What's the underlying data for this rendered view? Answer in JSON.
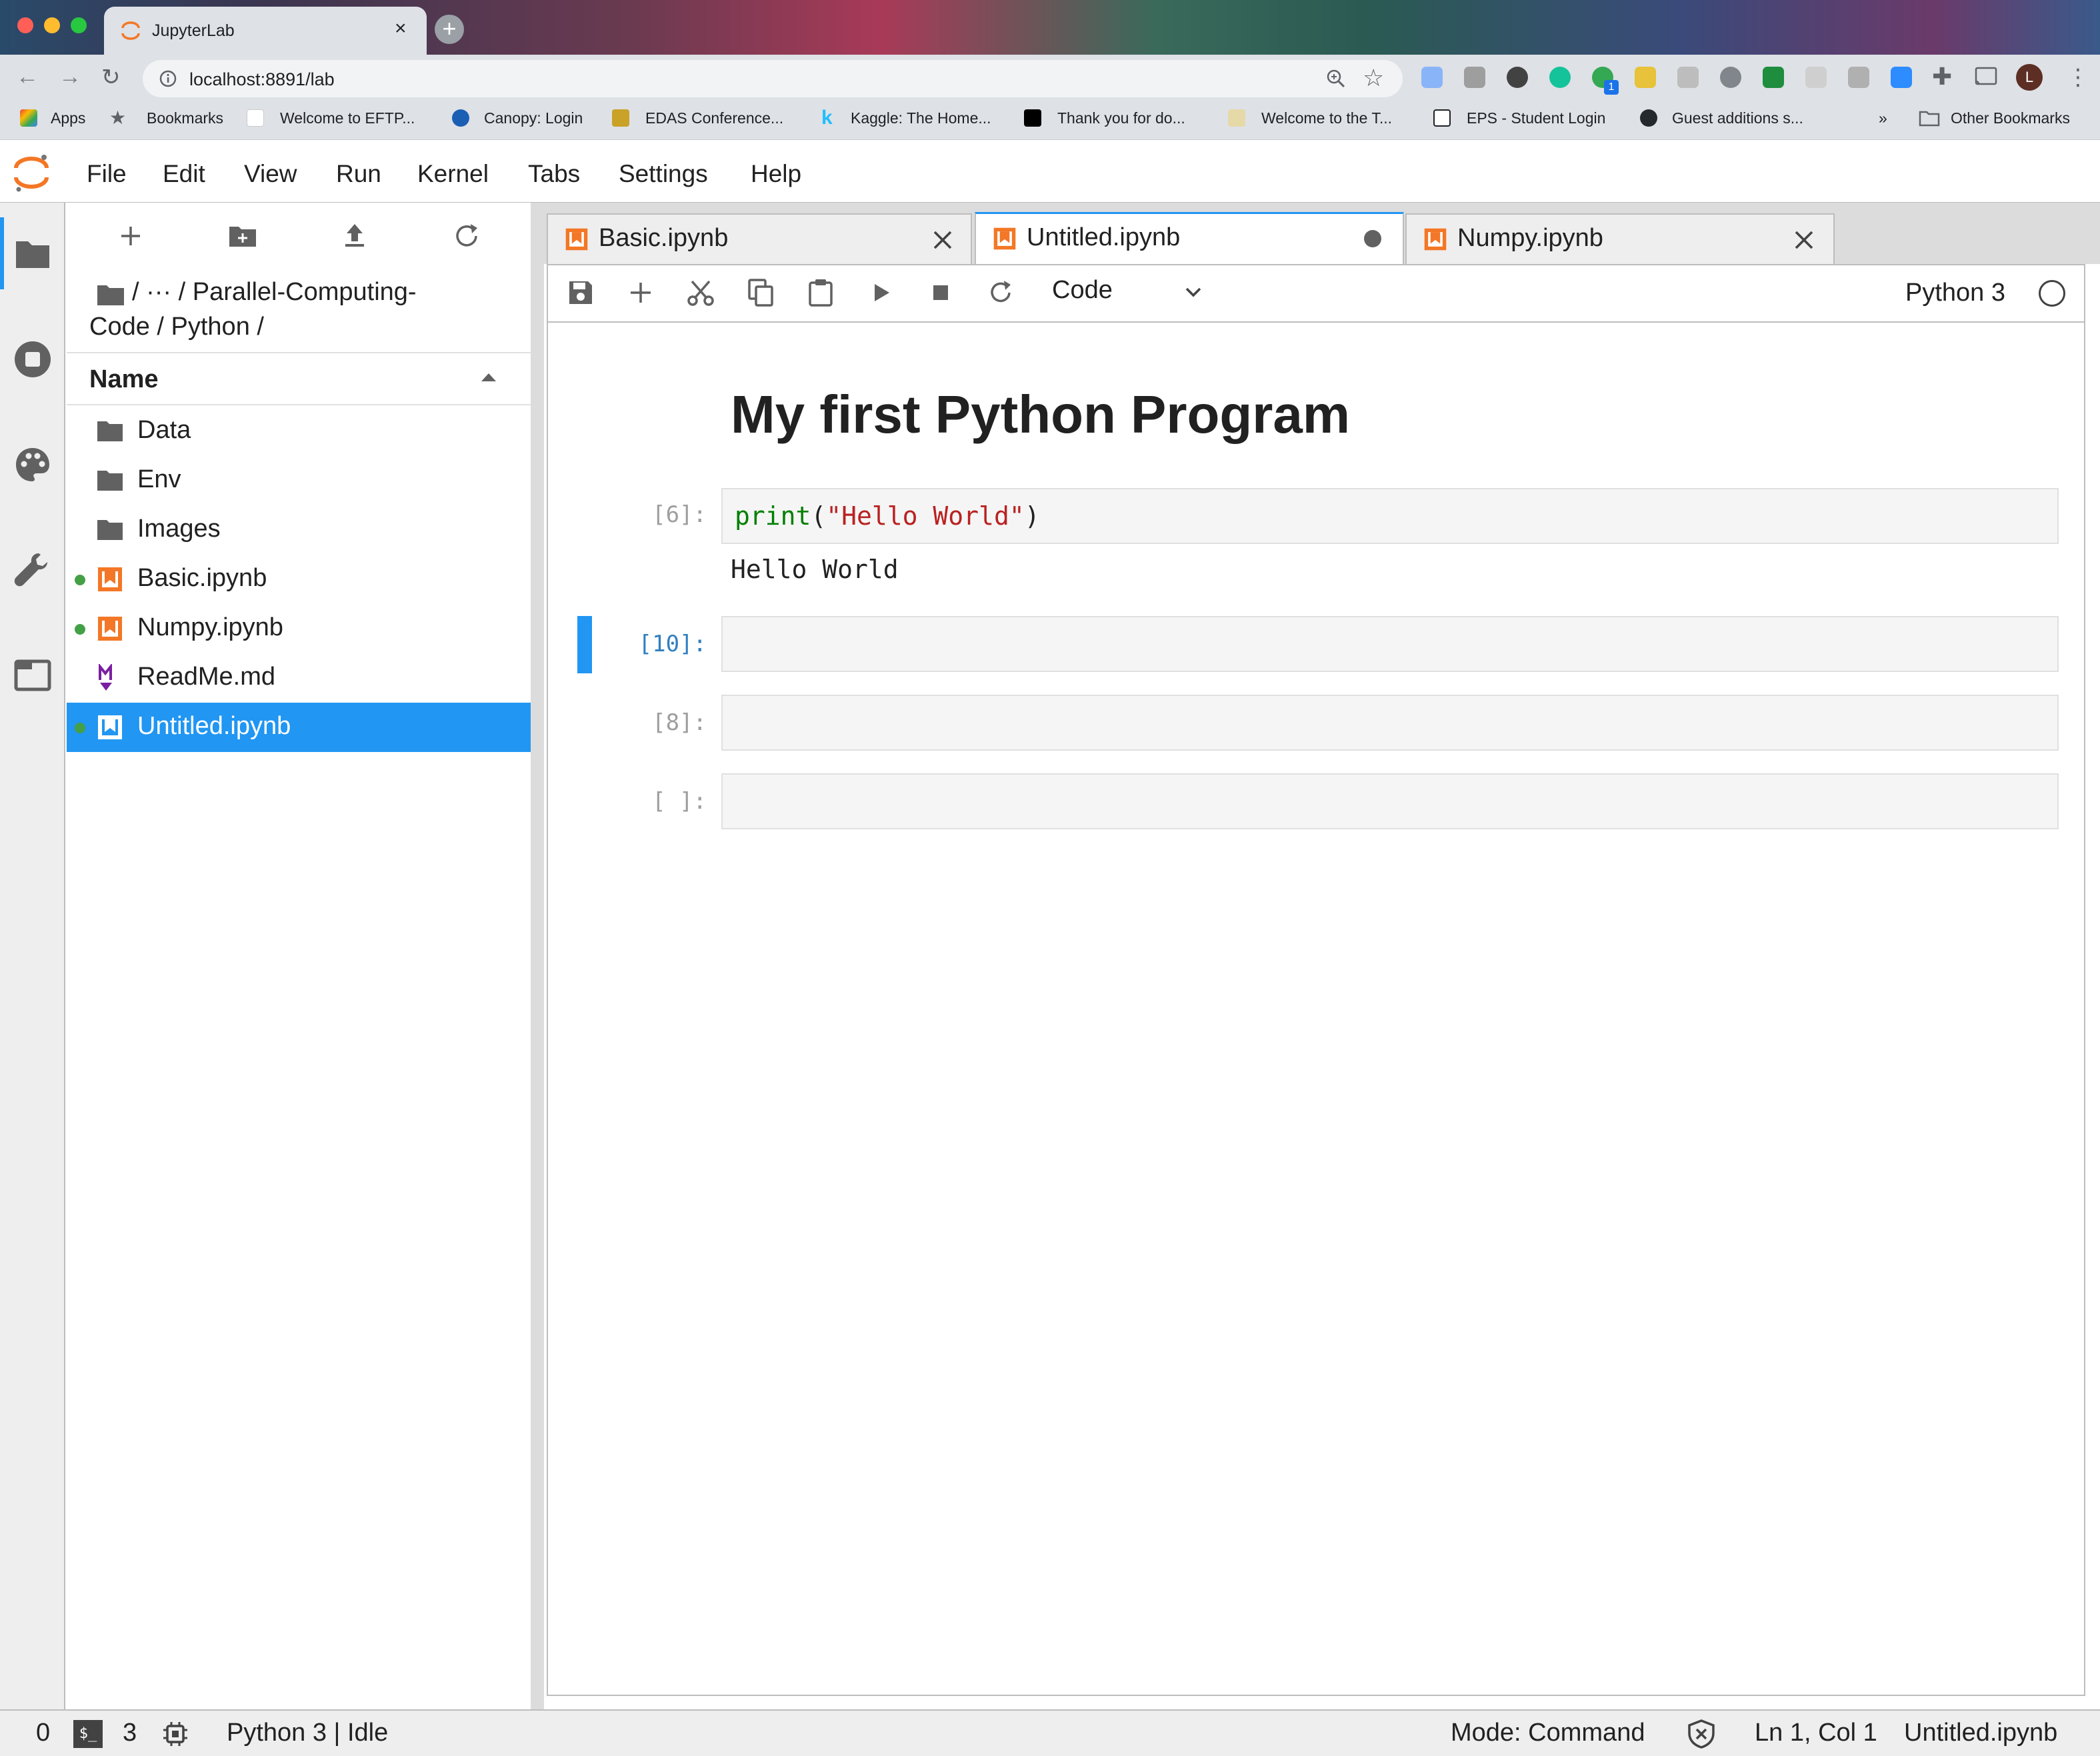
{
  "browser": {
    "tab_title": "JupyterLab",
    "tab_close": "×",
    "new_tab": "+",
    "url": "localhost:8891/lab",
    "bookmarks": [
      {
        "label": "Apps"
      },
      {
        "label": "Bookmarks"
      },
      {
        "label": "Welcome to EFTP..."
      },
      {
        "label": "Canopy: Login"
      },
      {
        "label": "EDAS Conference..."
      },
      {
        "label": "Kaggle: The Home..."
      },
      {
        "label": "Thank you for do..."
      },
      {
        "label": "Welcome to the T..."
      },
      {
        "label": "EPS - Student Login"
      },
      {
        "label": "Guest additions s..."
      }
    ],
    "bookmarks_overflow": "»",
    "other_bookmarks": "Other Bookmarks",
    "profile_initial": "L",
    "extension_badge": "1"
  },
  "menubar": {
    "items": [
      "File",
      "Edit",
      "View",
      "Run",
      "Kernel",
      "Tabs",
      "Settings",
      "Help"
    ]
  },
  "filebrowser": {
    "breadcrumb_line1": "/ ··· / Parallel-Computing-",
    "breadcrumb_line2": "Code / Python /",
    "header_name": "Name",
    "files": [
      {
        "name": "Data",
        "type": "folder",
        "running": false,
        "selected": false
      },
      {
        "name": "Env",
        "type": "folder",
        "running": false,
        "selected": false
      },
      {
        "name": "Images",
        "type": "folder",
        "running": false,
        "selected": false
      },
      {
        "name": "Basic.ipynb",
        "type": "notebook",
        "running": true,
        "selected": false
      },
      {
        "name": "Numpy.ipynb",
        "type": "notebook",
        "running": true,
        "selected": false
      },
      {
        "name": "ReadMe.md",
        "type": "markdown",
        "running": false,
        "selected": false
      },
      {
        "name": "Untitled.ipynb",
        "type": "notebook",
        "running": true,
        "selected": true
      }
    ]
  },
  "dock_tabs": [
    {
      "label": "Basic.ipynb",
      "active": false,
      "dirty": false
    },
    {
      "label": "Untitled.ipynb",
      "active": true,
      "dirty": true
    },
    {
      "label": "Numpy.ipynb",
      "active": false,
      "dirty": false
    }
  ],
  "notebook": {
    "cell_type": "Code",
    "kernel": "Python 3",
    "markdown_title": "My first Python Program",
    "cells": [
      {
        "prompt": "[6]:",
        "code_fn": "print",
        "code_open": "(",
        "code_str": "\"Hello World\"",
        "code_close": ")",
        "output": "Hello World",
        "active": false
      },
      {
        "prompt": "[10]:",
        "active": true
      },
      {
        "prompt": "[8]:",
        "active": false
      },
      {
        "prompt": "[ ]:",
        "active": false
      }
    ]
  },
  "statusbar": {
    "terminals": "0",
    "kernels": "3",
    "kernel_status": "Python 3 | Idle",
    "mode": "Mode: Command",
    "cursor": "Ln 1, Col 1",
    "file": "Untitled.ipynb"
  },
  "colors": {
    "accent": "#2196f3",
    "notebook_icon": "#f37726",
    "running_dot": "#43a047"
  }
}
